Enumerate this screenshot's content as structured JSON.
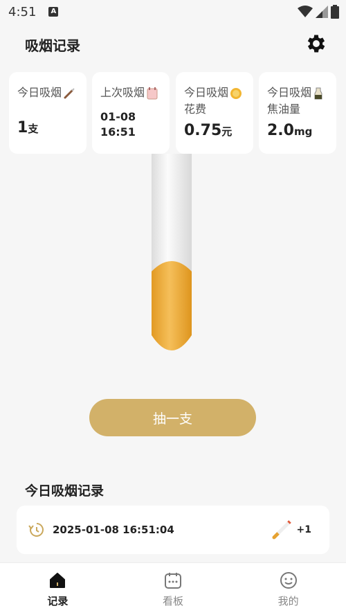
{
  "status_bar": {
    "time": "4:51",
    "app_icon_letter": "A",
    "icons": [
      "wifi-icon",
      "signal-icon",
      "battery-icon"
    ]
  },
  "header": {
    "title": "吸烟记录",
    "settings_icon": "gear-icon"
  },
  "stats": [
    {
      "label_line1": "今日吸烟",
      "label_line2": "",
      "value": "1",
      "unit": "支",
      "icon": "cigarette-icon"
    },
    {
      "label_line1": "上次吸烟",
      "label_line2": "",
      "value_line1": "01-08",
      "value_line2": "16:51",
      "icon": "calendar-icon"
    },
    {
      "label_line1": "今日吸烟",
      "label_line2": "花费",
      "value": "0.75",
      "unit": "元",
      "icon": "coin-icon"
    },
    {
      "label_line1": "今日吸烟",
      "label_line2": "焦油量",
      "value": "2.0",
      "unit": "mg",
      "icon": "tar-icon"
    }
  ],
  "cigarette": {
    "burned_fraction": 0.0,
    "filter_color": "#e6a232",
    "paper_color": "#f4f4f4"
  },
  "smoke_button": {
    "label": "抽一支"
  },
  "records": {
    "title": "今日吸烟记录",
    "items": [
      {
        "datetime": "2025-01-08 16:51:04",
        "count": "+1",
        "icon": "history-icon",
        "item_icon": "cigarette-icon"
      }
    ]
  },
  "bottom_nav": {
    "active": "记录",
    "items": [
      {
        "label": "记录",
        "icon": "home-icon"
      },
      {
        "label": "看板",
        "icon": "calendar-icon"
      },
      {
        "label": "我的",
        "icon": "smile-icon"
      }
    ]
  },
  "colors": {
    "accent": "#d2b169",
    "background": "#f6f6f6",
    "card": "#ffffff"
  }
}
